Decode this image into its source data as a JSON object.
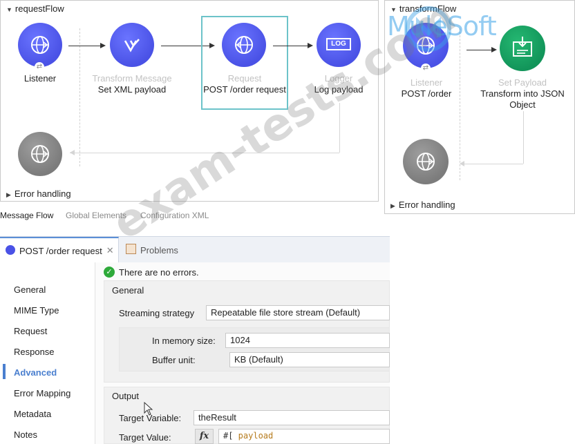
{
  "request_flow": {
    "title": "requestFlow",
    "nodes": [
      {
        "type": "",
        "name": "Listener"
      },
      {
        "type": "Transform Message",
        "name": "Set XML payload"
      },
      {
        "type": "Request",
        "name": "POST /order request"
      },
      {
        "type": "Logger",
        "name": "Log payload"
      }
    ],
    "logger_badge": "LOG",
    "error_handling": "Error handling"
  },
  "transform_flow": {
    "title": "transformFlow",
    "nodes": [
      {
        "type": "Listener",
        "name": "POST /order"
      },
      {
        "type": "Set Payload",
        "name": "Transform into JSON Object"
      }
    ],
    "error_handling": "Error handling"
  },
  "logo_text": "MuleSoft",
  "editor_tabs": [
    "Message Flow",
    "Global Elements",
    "Configuration XML"
  ],
  "panel_tabs": {
    "request": "POST /order request",
    "problems": "Problems"
  },
  "status": "There are no errors.",
  "nav_items": [
    "General",
    "MIME Type",
    "Request",
    "Response",
    "Advanced",
    "Error Mapping",
    "Metadata",
    "Notes"
  ],
  "general_section": {
    "title": "General",
    "streaming_label": "Streaming strategy",
    "streaming_value": "Repeatable file store stream (Default)",
    "memory_label": "In memory size:",
    "memory_value": "1024",
    "buffer_label": "Buffer unit:",
    "buffer_value": "KB (Default)"
  },
  "output_section": {
    "title": "Output",
    "target_variable_label": "Target Variable:",
    "target_variable_value": "theResult",
    "target_value_label": "Target Value:",
    "fx_label": "fx",
    "target_value_prefix": "#[",
    "target_value_keyword": " payload"
  },
  "watermark": "exam-tests.com",
  "colors": {
    "flow_node_purple": "#4a52e6",
    "error_node_gray": "#7c7c7c",
    "set_payload_green": "#12955a",
    "selection": "#6cc3c9",
    "nav_active": "#4a7fcf"
  }
}
